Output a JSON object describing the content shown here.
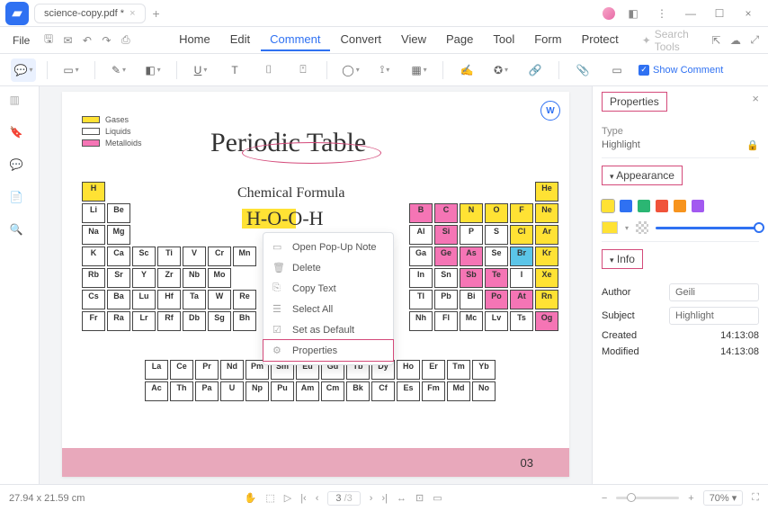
{
  "titlebar": {
    "tab_name": "science-copy.pdf *"
  },
  "menubar": {
    "file": "File",
    "items": [
      "Home",
      "Edit",
      "Comment",
      "Convert",
      "View",
      "Page",
      "Tool",
      "Form",
      "Protect"
    ],
    "active_index": 2,
    "search_placeholder": "Search Tools"
  },
  "toolbar": {
    "show_comment": "Show Comment"
  },
  "document": {
    "title": "Periodic Table",
    "subtitle": "Chemical Formula",
    "formula": "H-O-O-H",
    "legend": {
      "gases": "Gases",
      "liquids": "Liquids",
      "metalloids": "Metalloids"
    },
    "page_number": "03",
    "elements": {
      "r1": [
        {
          "s": "H",
          "c": "y",
          "x": 0
        },
        {
          "s": "He",
          "c": "y",
          "x": 17
        }
      ],
      "r2": [
        {
          "s": "Li",
          "x": 0
        },
        {
          "s": "Be",
          "x": 1
        },
        {
          "s": "B",
          "c": "p",
          "x": 12
        },
        {
          "s": "C",
          "c": "p",
          "x": 13
        },
        {
          "s": "N",
          "c": "y",
          "x": 14
        },
        {
          "s": "O",
          "c": "y",
          "x": 15
        },
        {
          "s": "F",
          "c": "y",
          "x": 16
        },
        {
          "s": "Ne",
          "c": "y",
          "x": 17
        }
      ],
      "r3": [
        {
          "s": "Na",
          "x": 0
        },
        {
          "s": "Mg",
          "x": 1
        },
        {
          "s": "Al",
          "c": "",
          "x": 12
        },
        {
          "s": "Si",
          "c": "p",
          "x": 13
        },
        {
          "s": "P",
          "x": 14
        },
        {
          "s": "S",
          "x": 15
        },
        {
          "s": "Cl",
          "c": "y",
          "x": 16
        },
        {
          "s": "Ar",
          "c": "y",
          "x": 17
        }
      ],
      "r4": [
        {
          "s": "K",
          "x": 0
        },
        {
          "s": "Ca",
          "x": 1
        },
        {
          "s": "Sc",
          "x": 2
        },
        {
          "s": "Ti",
          "x": 3
        },
        {
          "s": "V",
          "x": 4
        },
        {
          "s": "Cr",
          "x": 5
        },
        {
          "s": "Mn",
          "x": 6
        },
        {
          "s": "Ga",
          "x": 12
        },
        {
          "s": "Ge",
          "c": "p",
          "x": 13
        },
        {
          "s": "As",
          "c": "p",
          "x": 14
        },
        {
          "s": "Se",
          "x": 15
        },
        {
          "s": "Br",
          "c": "c",
          "x": 16
        },
        {
          "s": "Kr",
          "c": "y",
          "x": 17
        }
      ],
      "r5": [
        {
          "s": "Rb",
          "x": 0
        },
        {
          "s": "Sr",
          "x": 1
        },
        {
          "s": "Y",
          "x": 2
        },
        {
          "s": "Zr",
          "x": 3
        },
        {
          "s": "Nb",
          "x": 4
        },
        {
          "s": "Mo",
          "x": 5
        },
        {
          "s": "In",
          "x": 12
        },
        {
          "s": "Sn",
          "x": 13
        },
        {
          "s": "Sb",
          "c": "p",
          "x": 14
        },
        {
          "s": "Te",
          "c": "p",
          "x": 15
        },
        {
          "s": "I",
          "x": 16
        },
        {
          "s": "Xe",
          "c": "y",
          "x": 17
        }
      ],
      "r6": [
        {
          "s": "Cs",
          "x": 0
        },
        {
          "s": "Ba",
          "x": 1
        },
        {
          "s": "Lu",
          "x": 2
        },
        {
          "s": "Hf",
          "x": 3
        },
        {
          "s": "Ta",
          "x": 4
        },
        {
          "s": "W",
          "x": 5
        },
        {
          "s": "Re",
          "x": 6
        },
        {
          "s": "Tl",
          "x": 12
        },
        {
          "s": "Pb",
          "x": 13
        },
        {
          "s": "Bi",
          "x": 14
        },
        {
          "s": "Po",
          "c": "p",
          "x": 15
        },
        {
          "s": "At",
          "c": "p",
          "x": 16
        },
        {
          "s": "Rn",
          "c": "y",
          "x": 17
        }
      ],
      "r7": [
        {
          "s": "Fr",
          "x": 0
        },
        {
          "s": "Ra",
          "x": 1
        },
        {
          "s": "Lr",
          "x": 2
        },
        {
          "s": "Rf",
          "x": 3
        },
        {
          "s": "Db",
          "x": 4
        },
        {
          "s": "Sg",
          "x": 5
        },
        {
          "s": "Bh",
          "x": 6
        },
        {
          "s": "Nh",
          "x": 12
        },
        {
          "s": "Fl",
          "x": 13
        },
        {
          "s": "Mc",
          "x": 14
        },
        {
          "s": "Lv",
          "x": 15
        },
        {
          "s": "Ts",
          "x": 16
        },
        {
          "s": "Og",
          "c": "p",
          "x": 17
        }
      ],
      "la": [
        {
          "s": "La"
        },
        {
          "s": "Ce"
        },
        {
          "s": "Pr"
        },
        {
          "s": "Nd"
        },
        {
          "s": "Pm"
        },
        {
          "s": "Sm"
        },
        {
          "s": "Eu"
        },
        {
          "s": "Gd"
        },
        {
          "s": "Tb"
        },
        {
          "s": "Dy"
        },
        {
          "s": "Ho"
        },
        {
          "s": "Er"
        },
        {
          "s": "Tm"
        },
        {
          "s": "Yb"
        }
      ],
      "ac": [
        {
          "s": "Ac"
        },
        {
          "s": "Th"
        },
        {
          "s": "Pa"
        },
        {
          "s": "U"
        },
        {
          "s": "Np"
        },
        {
          "s": "Pu"
        },
        {
          "s": "Am"
        },
        {
          "s": "Cm"
        },
        {
          "s": "Bk"
        },
        {
          "s": "Cf"
        },
        {
          "s": "Es"
        },
        {
          "s": "Fm"
        },
        {
          "s": "Md"
        },
        {
          "s": "No"
        }
      ]
    }
  },
  "context_menu": {
    "items": [
      "Open Pop-Up Note",
      "Delete",
      "Copy Text",
      "Select All",
      "Set as Default",
      "Properties"
    ],
    "highlighted_index": 5
  },
  "properties": {
    "header": "Properties",
    "type_label": "Type",
    "type_value": "Highlight",
    "appearance_header": "Appearance",
    "swatch_colors": [
      "#ffe234",
      "#2f71f2",
      "#2bb673",
      "#f0533a",
      "#f7941e",
      "#a259f0"
    ],
    "info_header": "Info",
    "author_label": "Author",
    "author_value": "Geili",
    "subject_label": "Subject",
    "subject_value": "Highlight",
    "created_label": "Created",
    "created_value": "14:13:08",
    "modified_label": "Modified",
    "modified_value": "14:13:08"
  },
  "statusbar": {
    "dimensions": "27.94 x 21.59 cm",
    "page_current": "3",
    "page_total": "/3",
    "zoom": "70%"
  }
}
